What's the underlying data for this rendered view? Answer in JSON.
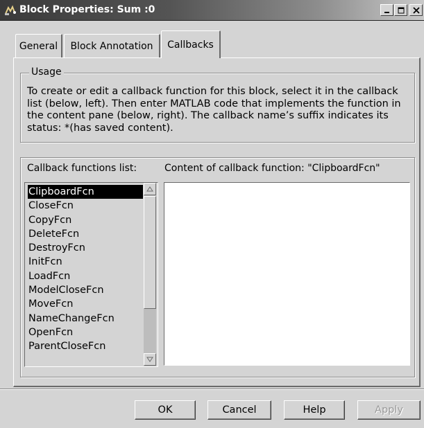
{
  "window": {
    "title": "Block Properties: Sum :0",
    "icon": "simulink-block-icon",
    "controls": [
      "minimize-icon",
      "maximize-icon",
      "close-icon"
    ]
  },
  "tabs": [
    {
      "label": "General",
      "active": false
    },
    {
      "label": "Block Annotation",
      "active": false
    },
    {
      "label": "Callbacks",
      "active": true
    }
  ],
  "usage": {
    "legend": "Usage",
    "text": "To create or edit a callback function for this block, select it in the callback list (below, left). Then enter MATLAB code that implements the function in the content pane (below, right). The callback name’s suffix indicates its status: *(has saved content)."
  },
  "callbacks": {
    "list_label": "Callback functions list:",
    "content_label": "Content of callback function:  \"ClipboardFcn\"",
    "selected": "ClipboardFcn",
    "items": [
      "ClipboardFcn",
      "CloseFcn",
      "CopyFcn",
      "DeleteFcn",
      "DestroyFcn",
      "InitFcn",
      "LoadFcn",
      "ModelCloseFcn",
      "MoveFcn",
      "NameChangeFcn",
      "OpenFcn",
      "ParentCloseFcn"
    ],
    "content_value": ""
  },
  "buttons": {
    "ok": "OK",
    "cancel": "Cancel",
    "help": "Help",
    "apply": "Apply"
  },
  "colors": {
    "dialog_bg": "#d4d4d4",
    "selection_bg": "#000000",
    "selection_fg": "#ffffff"
  }
}
